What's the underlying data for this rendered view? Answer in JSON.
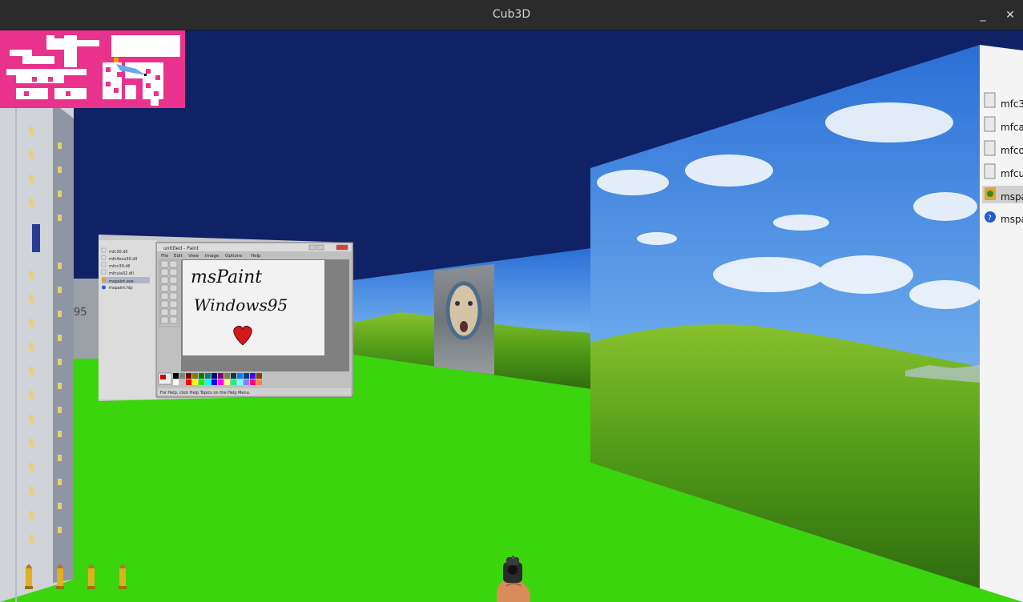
{
  "window": {
    "title": "Cub3D",
    "minimize_glyph": "_",
    "close_glyph": "✕"
  },
  "colors": {
    "ceiling": "#0f2266",
    "floor": "#3ad50c",
    "minimap_wall": "#e8328c",
    "minimap_floor": "#ffffff",
    "minimap_player": "#ff9900"
  },
  "paint_wall": {
    "line1": "msPaint",
    "line2": "Windows95",
    "window_title": "untitled - Paint",
    "menu": [
      "File",
      "Edit",
      "View",
      "Image",
      "Options",
      "Help"
    ],
    "status": "For Help, click Help Topics on the Help Menu.",
    "files": [
      "mfc30.dll",
      "mfc4ocx30.dll",
      "mfcn30.dll",
      "mfcuia32.dll",
      "mspaint.exe",
      "mspaint.hlp"
    ],
    "ghost_text": "95"
  },
  "right_wall_files": [
    "mfc3",
    "mfca",
    "mfco",
    "mfcu",
    "mspa",
    "mspa"
  ],
  "hud": {
    "ammo_count": 4,
    "weapon": "pistol"
  }
}
